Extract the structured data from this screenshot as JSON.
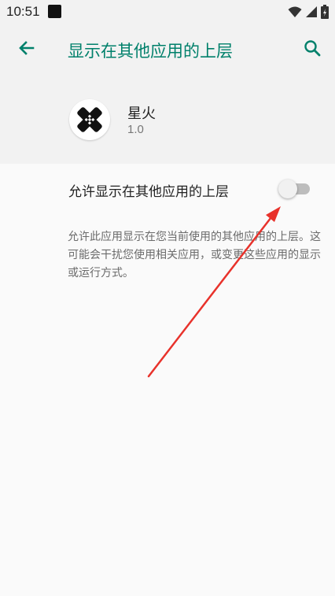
{
  "status_bar": {
    "time": "10:51"
  },
  "app_bar": {
    "title": "显示在其他应用的上层"
  },
  "app_info": {
    "name": "星火",
    "version": "1.0"
  },
  "setting": {
    "label": "允许显示在其他应用的上层",
    "enabled": false
  },
  "description": "允许此应用显示在您当前使用的其他应用的上层。这可能会干扰您使用相关应用，或变更这些应用的显示或运行方式。",
  "colors": {
    "accent": "#00806b",
    "annotation_arrow": "#e8322b",
    "toggle_off_track": "#bdbdbd"
  },
  "icons": {
    "back": "arrow-left-icon",
    "search": "search-icon",
    "wifi": "wifi-icon",
    "signal": "signal-icon",
    "battery": "battery-icon"
  }
}
